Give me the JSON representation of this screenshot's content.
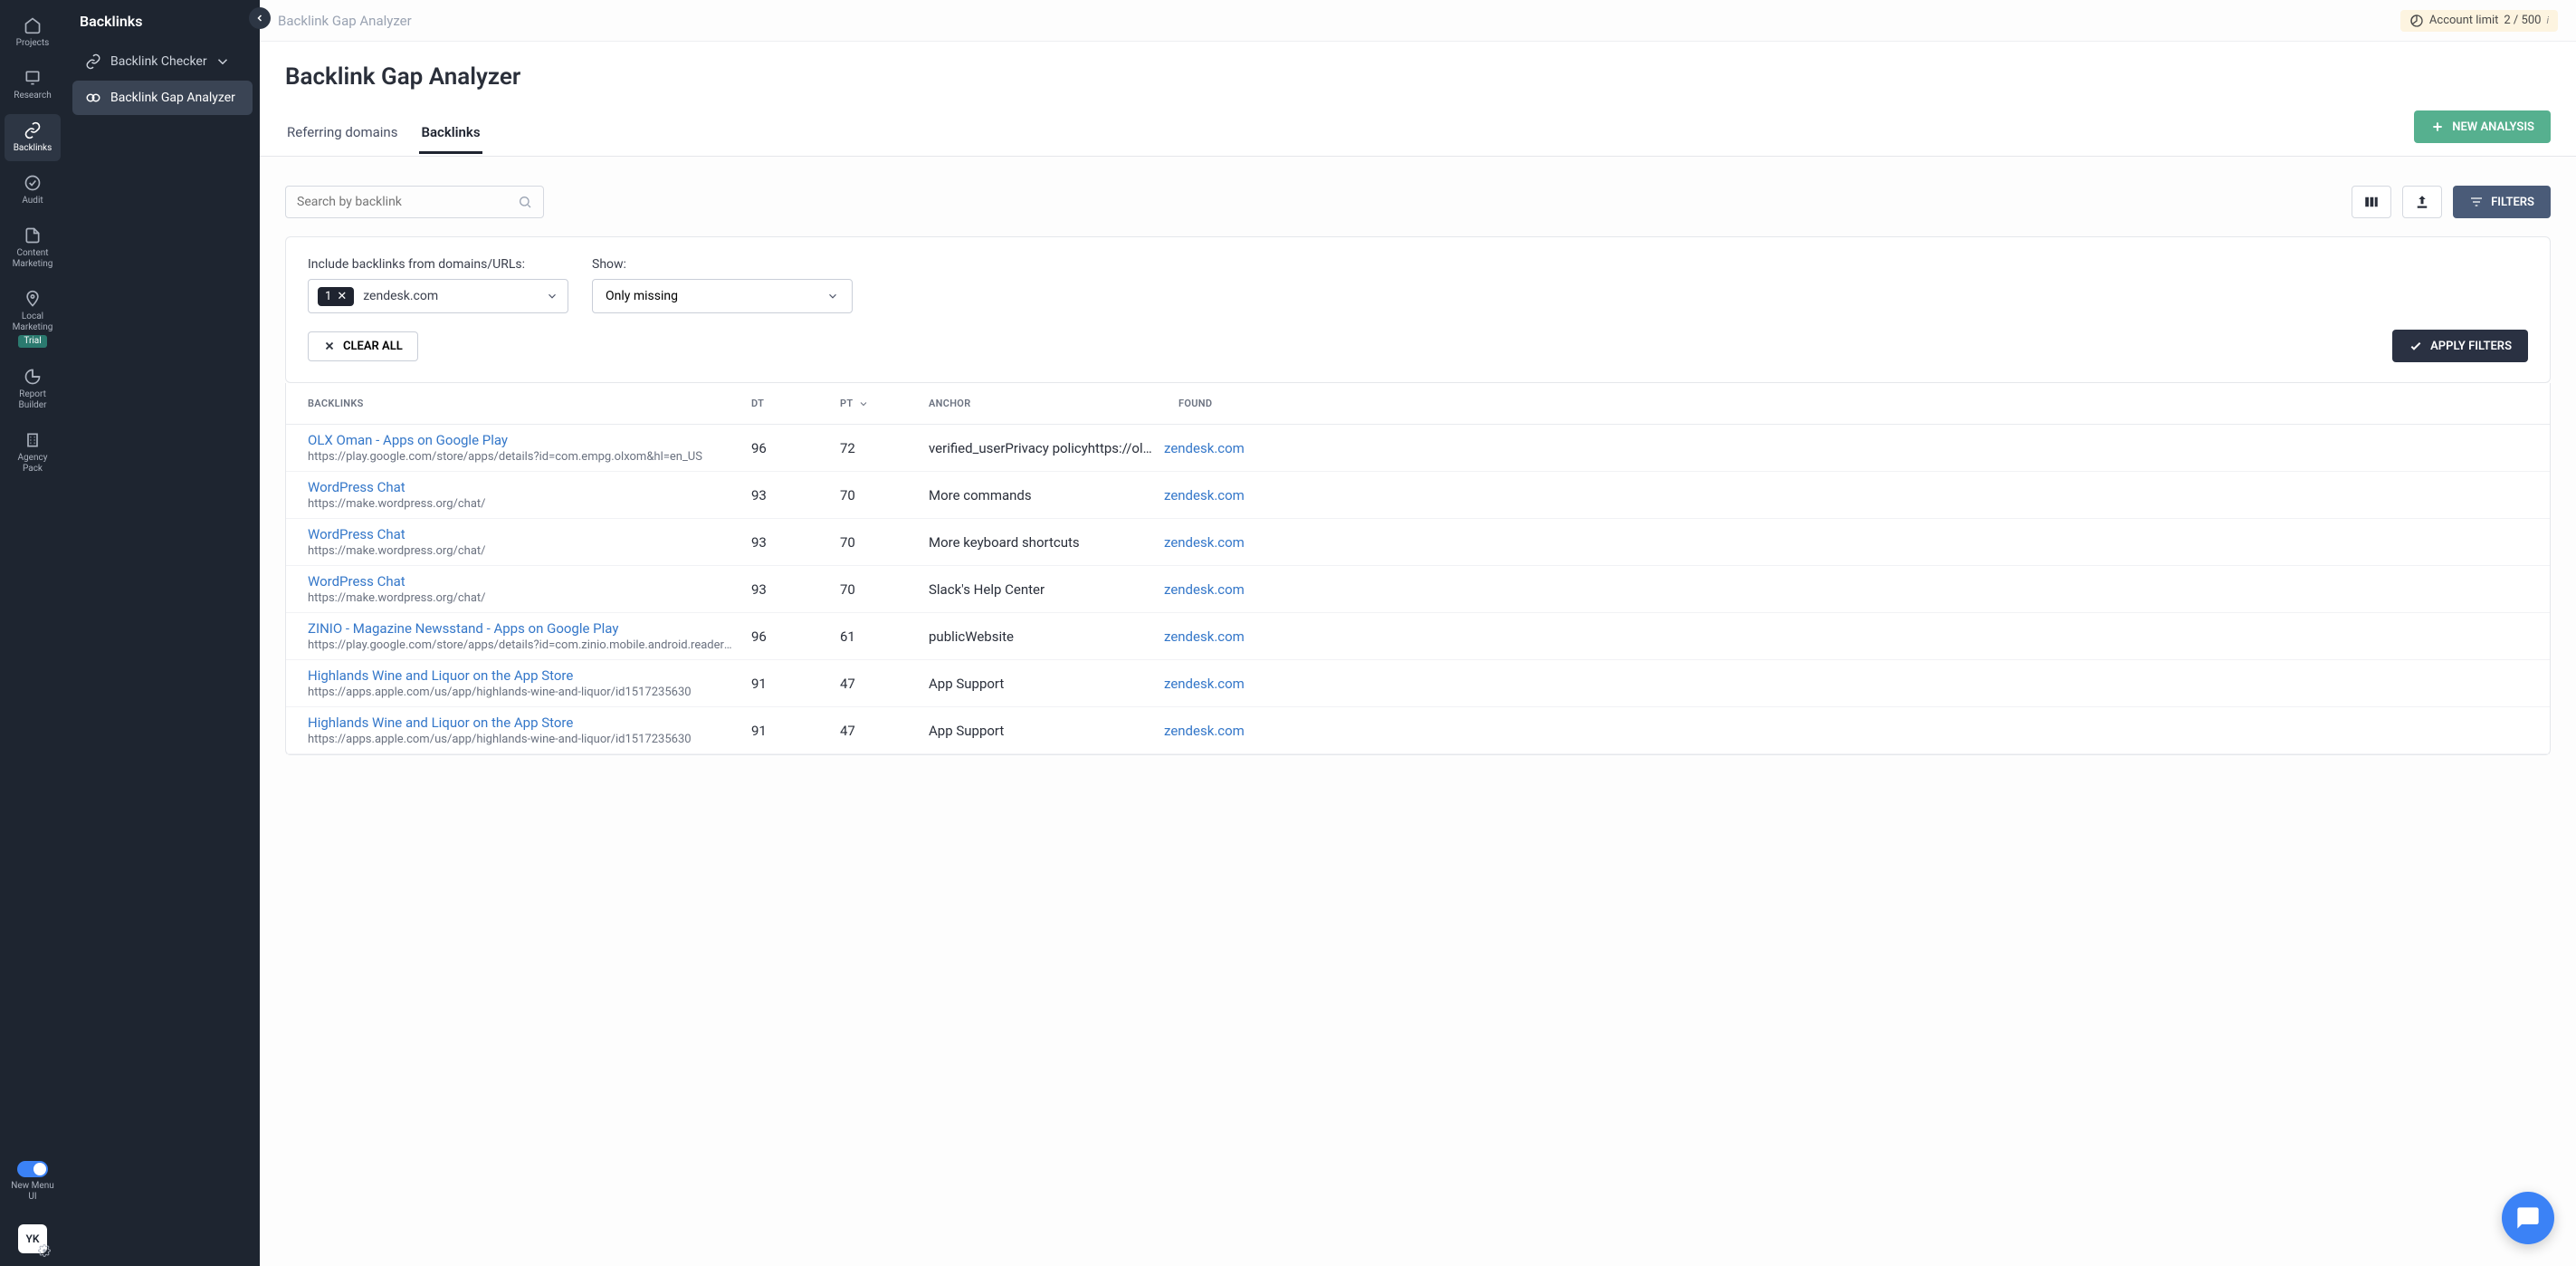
{
  "rail": {
    "items": [
      {
        "label": "Projects"
      },
      {
        "label": "Research"
      },
      {
        "label": "Backlinks"
      },
      {
        "label": "Audit"
      },
      {
        "label": "Content Marketing"
      },
      {
        "label": "Local Marketing",
        "badge": "Trial"
      },
      {
        "label": "Report Builder"
      },
      {
        "label": "Agency Pack"
      }
    ],
    "menu_toggle_label": "New Menu UI",
    "avatar": "YK"
  },
  "sidebar": {
    "title": "Backlinks",
    "items": [
      {
        "label": "Backlink Checker"
      },
      {
        "label": "Backlink Gap Analyzer"
      }
    ]
  },
  "breadcrumb": "Backlink Gap Analyzer",
  "account_limit": {
    "label": "Account limit",
    "value": "2 / 500"
  },
  "page_title": "Backlink Gap Analyzer",
  "tabs": [
    {
      "label": "Referring domains"
    },
    {
      "label": "Backlinks"
    }
  ],
  "buttons": {
    "new_analysis": "NEW ANALYSIS",
    "filters": "FILTERS",
    "clear_all": "CLEAR ALL",
    "apply_filters": "APPLY FILTERS"
  },
  "search": {
    "placeholder": "Search by backlink"
  },
  "filters": {
    "include_label": "Include backlinks from domains/URLs:",
    "include_chip_count": "1",
    "include_value": "zendesk.com",
    "show_label": "Show:",
    "show_value": "Only missing"
  },
  "table": {
    "headers": {
      "backlinks": "BACKLINKS",
      "dt": "DT",
      "pt": "PT",
      "anchor": "ANCHOR",
      "found": "FOUND"
    },
    "rows": [
      {
        "title": "OLX Oman - Apps on Google Play",
        "url": "https://play.google.com/store/apps/details?id=com.empg.olxom&hl=en_US",
        "dt": "96",
        "pt": "72",
        "anchor": "verified_userPrivacy policyhttps://olx-...",
        "found": "zendesk.com"
      },
      {
        "title": "WordPress Chat",
        "url": "https://make.wordpress.org/chat/",
        "dt": "93",
        "pt": "70",
        "anchor": "More commands",
        "found": "zendesk.com"
      },
      {
        "title": "WordPress Chat",
        "url": "https://make.wordpress.org/chat/",
        "dt": "93",
        "pt": "70",
        "anchor": "More keyboard shortcuts",
        "found": "zendesk.com"
      },
      {
        "title": "WordPress Chat",
        "url": "https://make.wordpress.org/chat/",
        "dt": "93",
        "pt": "70",
        "anchor": "Slack's Help Center",
        "found": "zendesk.com"
      },
      {
        "title": "ZINIO - Magazine Newsstand - Apps on Google Play",
        "url": "https://play.google.com/store/apps/details?id=com.zinio.mobile.android.reader&hl=en...",
        "dt": "96",
        "pt": "61",
        "anchor": "publicWebsite",
        "found": "zendesk.com"
      },
      {
        "title": "Highlands Wine and Liquor on the App Store",
        "url": "https://apps.apple.com/us/app/highlands-wine-and-liquor/id1517235630",
        "dt": "91",
        "pt": "47",
        "anchor": "App Support",
        "found": "zendesk.com"
      },
      {
        "title": "Highlands Wine and Liquor on the App Store",
        "url": "https://apps.apple.com/us/app/highlands-wine-and-liquor/id1517235630",
        "dt": "91",
        "pt": "47",
        "anchor": "App Support",
        "found": "zendesk.com"
      }
    ]
  }
}
